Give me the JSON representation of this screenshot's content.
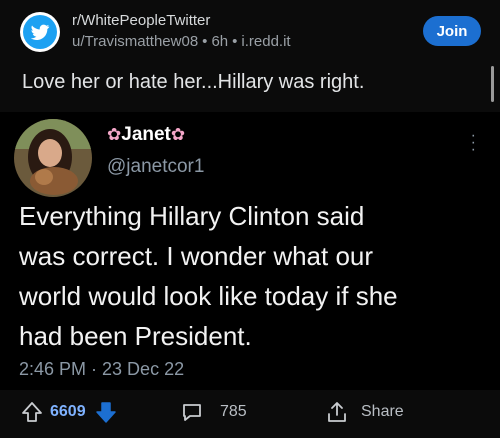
{
  "post": {
    "subreddit": "r/WhitePeopleTwitter",
    "author": "u/Travismatthew08",
    "age": "6h",
    "domain": "i.redd.it",
    "join_label": "Join",
    "title": "Love her or hate her...Hillary was right."
  },
  "tweet": {
    "display_name": "Janet",
    "handle": "@janetcor1",
    "lines": [
      "Everything Hillary Clinton said",
      "was correct. I wonder what our",
      "world would look like today if she",
      "had been President."
    ],
    "timestamp": "2:46 PM · 23 Dec 22"
  },
  "actions": {
    "votes": "6609",
    "comments": "785",
    "share_label": "Share"
  },
  "colors": {
    "accent": "#1c6fd1",
    "upvoted": "#7fb2ff",
    "background": "#0b0b0b"
  }
}
